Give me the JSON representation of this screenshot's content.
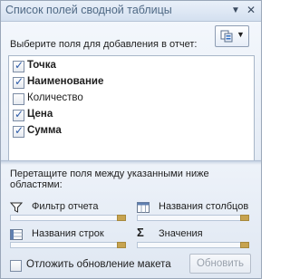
{
  "title": "Список полей сводной таблицы",
  "prompt_label": "Выберите поля для добавления в отчет:",
  "fields": [
    {
      "label": "Точка",
      "checked": true,
      "bold": true
    },
    {
      "label": "Наименование",
      "checked": true,
      "bold": true
    },
    {
      "label": "Количество",
      "checked": false,
      "bold": false
    },
    {
      "label": "Цена",
      "checked": true,
      "bold": true
    },
    {
      "label": "Сумма",
      "checked": true,
      "bold": true
    }
  ],
  "drag_prompt": "Перетащите поля между указанными ниже областями:",
  "areas": {
    "report_filter": {
      "label": "Фильтр отчета",
      "icon": "filter-icon"
    },
    "column_labels": {
      "label": "Названия столбцов",
      "icon": "columns-icon"
    },
    "row_labels": {
      "label": "Названия строк",
      "icon": "rows-icon"
    },
    "values": {
      "label": "Значения",
      "icon": "sigma-icon"
    }
  },
  "defer_update": {
    "label": "Отложить обновление макета",
    "checked": false
  },
  "update_button": {
    "label": "Обновить",
    "enabled": false
  },
  "colors": {
    "title_text": "#4f6985",
    "accent_check": "#2c5aa8"
  }
}
